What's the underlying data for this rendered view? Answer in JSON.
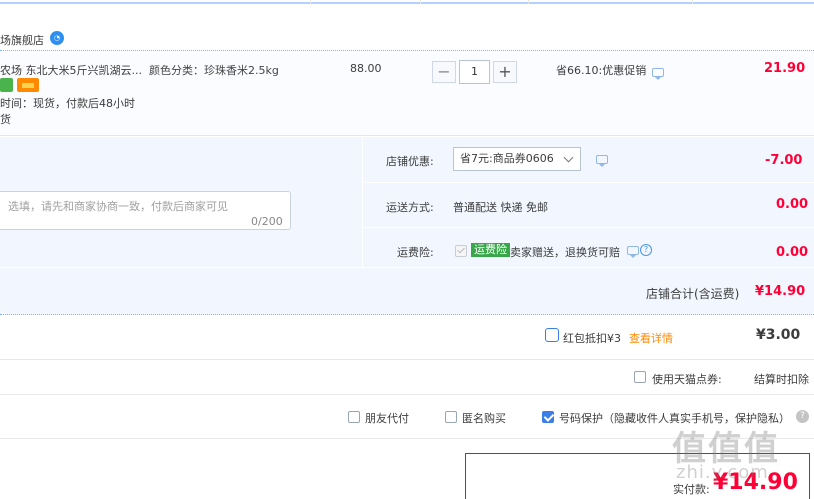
{
  "store": {
    "name": "场旗舰店",
    "chat_icon": "wangwang-icon"
  },
  "item": {
    "title": "农场 东北大米5斤兴凯湖云...",
    "sku": "颜色分类：珍珠香米2.5kg",
    "ship_time": "时间：现货，付款后48小时",
    "stock": "货",
    "unit_price": "88.00",
    "quantity": "1",
    "minus_label": "−",
    "plus_label": "+",
    "promo": "省66.10:优惠促销",
    "subtotal": "21.90"
  },
  "extras": {
    "coupon_label": "店铺优惠:",
    "coupon_value": "省7元:商品券0606",
    "coupon_amount": "-7.00",
    "shipping_label": "运送方式:",
    "shipping_value": "普通配送 快递 免邮",
    "shipping_amount": "0.00",
    "insurance_label": "运费险:",
    "insurance_badge": "运费险",
    "insurance_desc": "卖家赠送，退换货可赔",
    "insurance_amount": "0.00",
    "message_placeholder": "选填，请先和商家协商一致，付款后商家可见",
    "message_count": "0/200"
  },
  "store_total": {
    "label": "店铺合计(含运费)",
    "value": "¥14.90"
  },
  "redpacket": {
    "label": "红包抵扣¥3",
    "link": "查看详情",
    "value": "¥3.00"
  },
  "tmall_points": {
    "label": "使用天猫点券:",
    "note": "结算时扣除"
  },
  "options": {
    "friend_pay": "朋友代付",
    "anonymous": "匿名购买",
    "privacy": "号码保护（隐藏收件人真实手机号，保护隐私）"
  },
  "payment": {
    "label": "实付款:",
    "value": "¥14.90"
  },
  "watermark": {
    "main": "值值值",
    "sub": "zhi.y.com"
  }
}
